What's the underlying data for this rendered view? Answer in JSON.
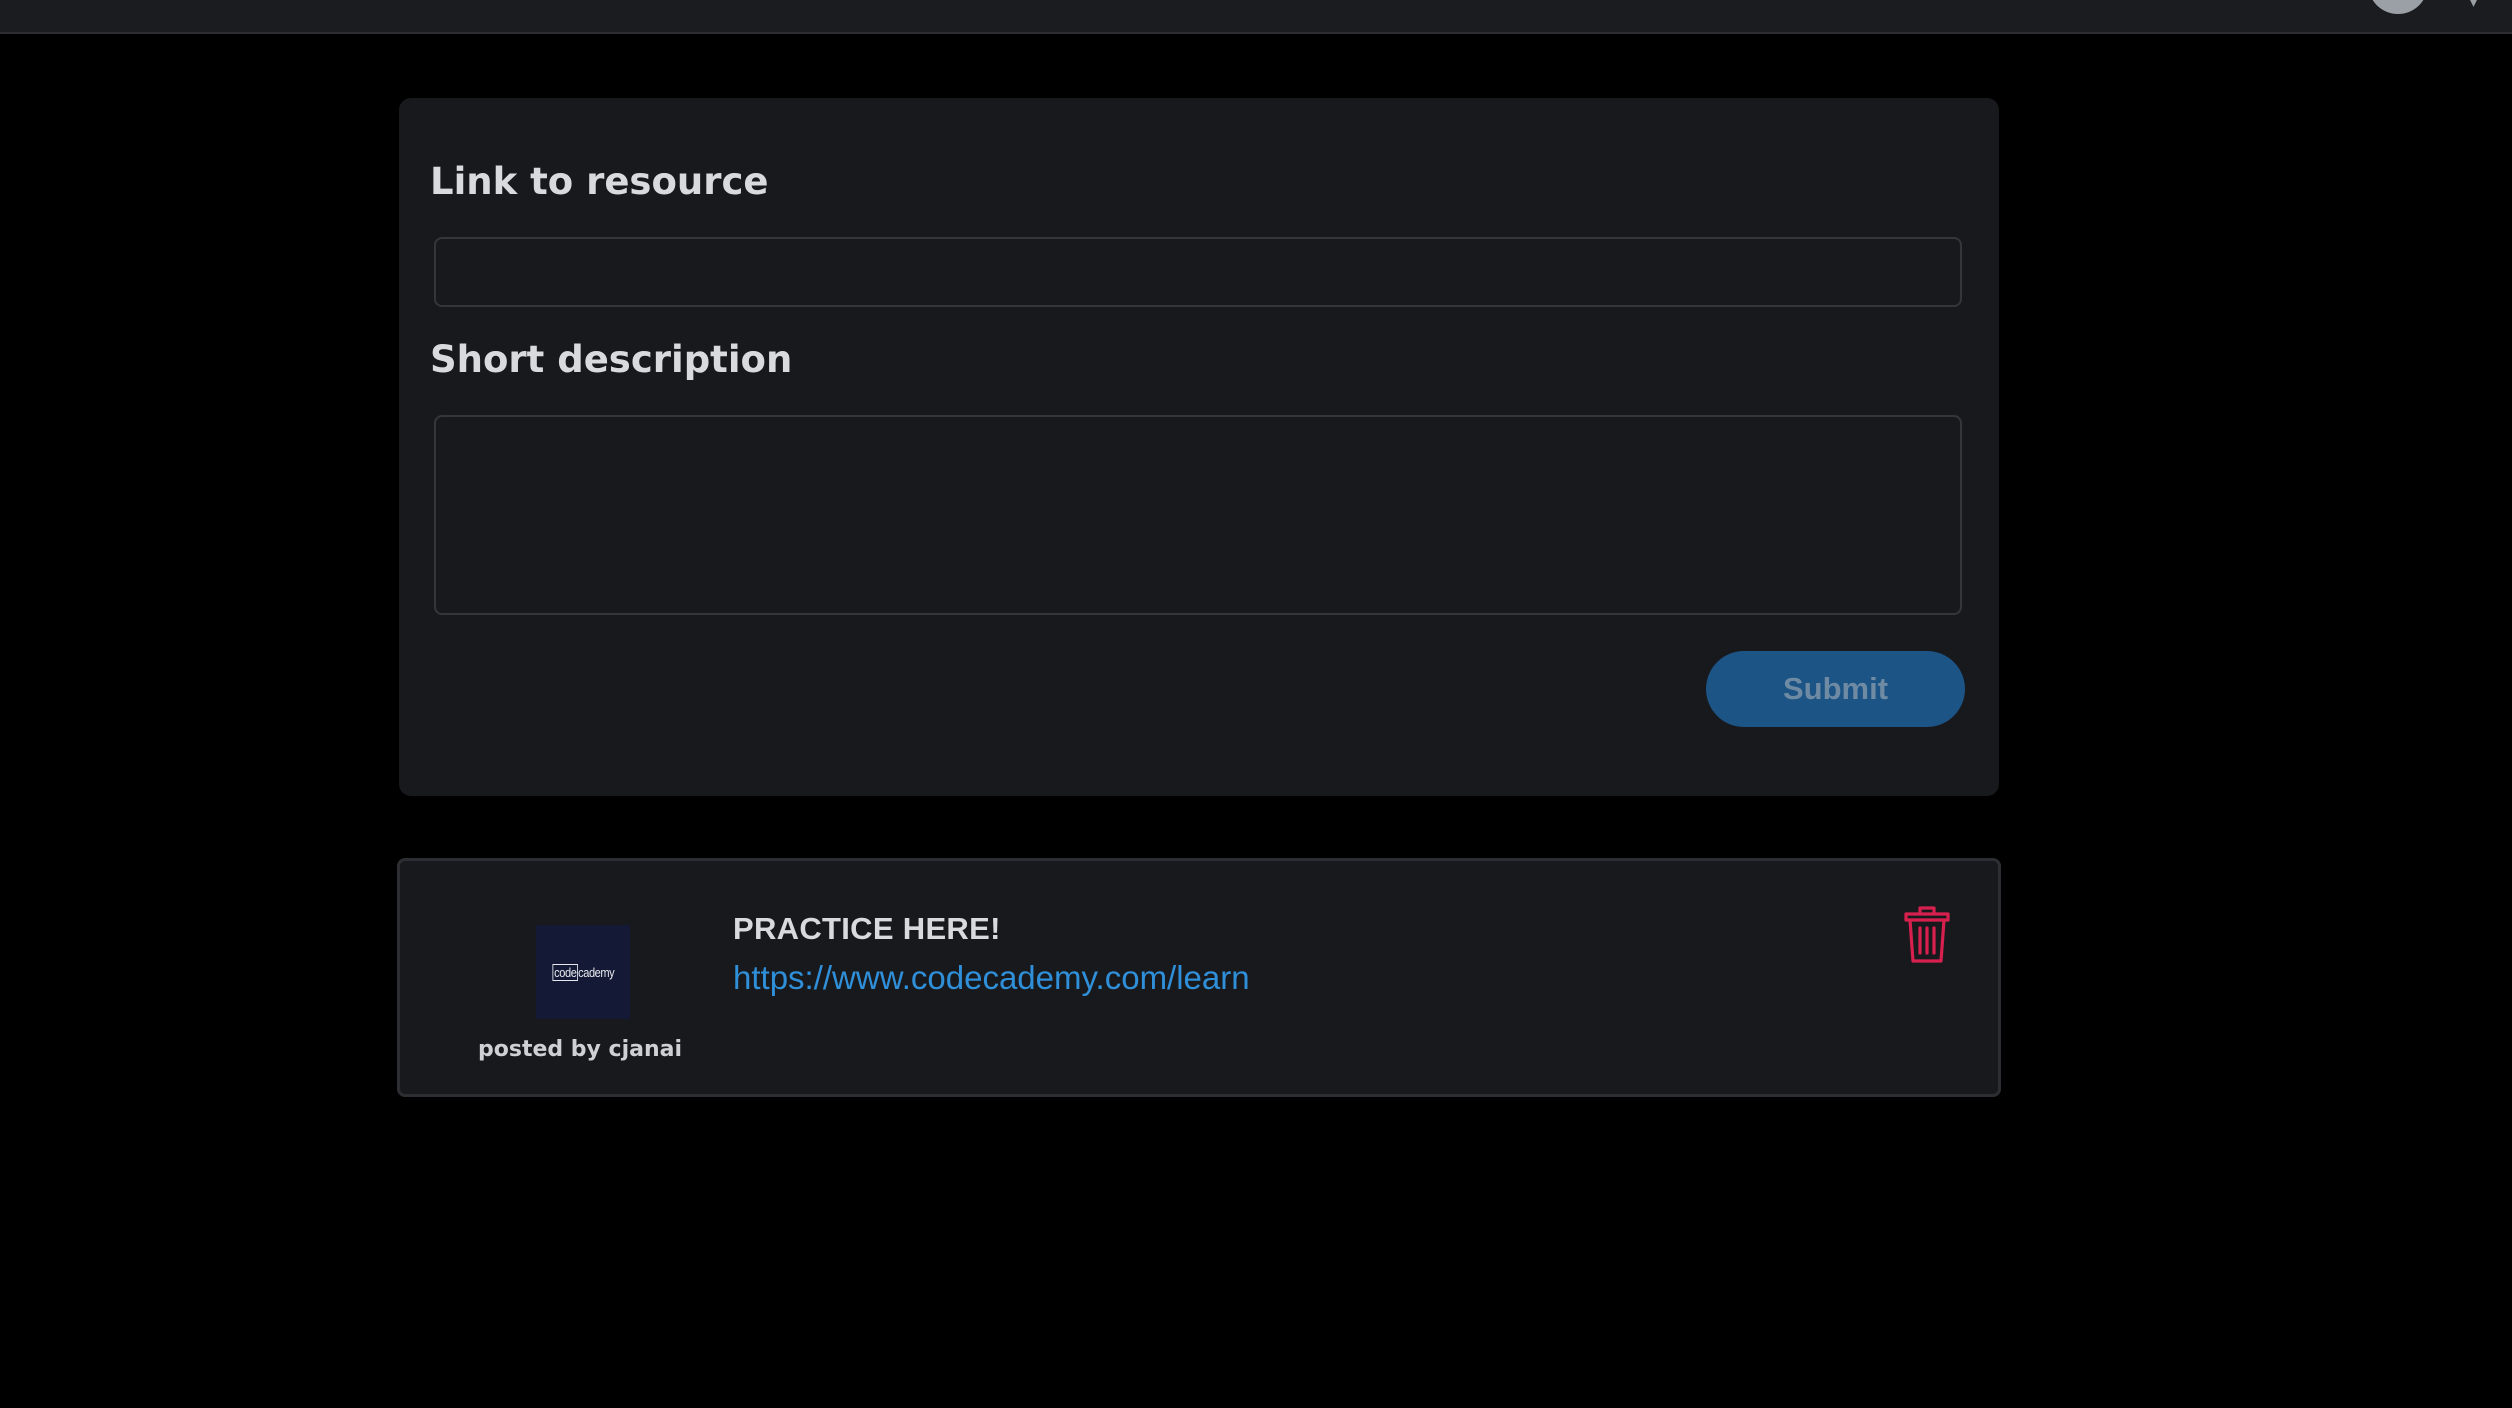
{
  "colors": {
    "page_background": "#000000",
    "card_background": "#18191d",
    "primary_button": "#1c5486",
    "link": "#2f8fd8",
    "delete_icon": "#d8204f"
  },
  "header": {
    "avatar_icon": "user-avatar-icon",
    "menu_icon": "chevron-down-icon"
  },
  "form": {
    "link_label": "Link to resource",
    "link_value": "",
    "description_label": "Short description",
    "description_value": "",
    "submit_label": "Submit"
  },
  "posts": [
    {
      "title": "PRACTICE HERE!",
      "url": "https://www.codecademy.com/learn",
      "author_text": "posted by cjanai",
      "thumbnail_text_boxed": "code",
      "thumbnail_text_rest": "cademy",
      "delete_icon": "trash-icon"
    }
  ]
}
